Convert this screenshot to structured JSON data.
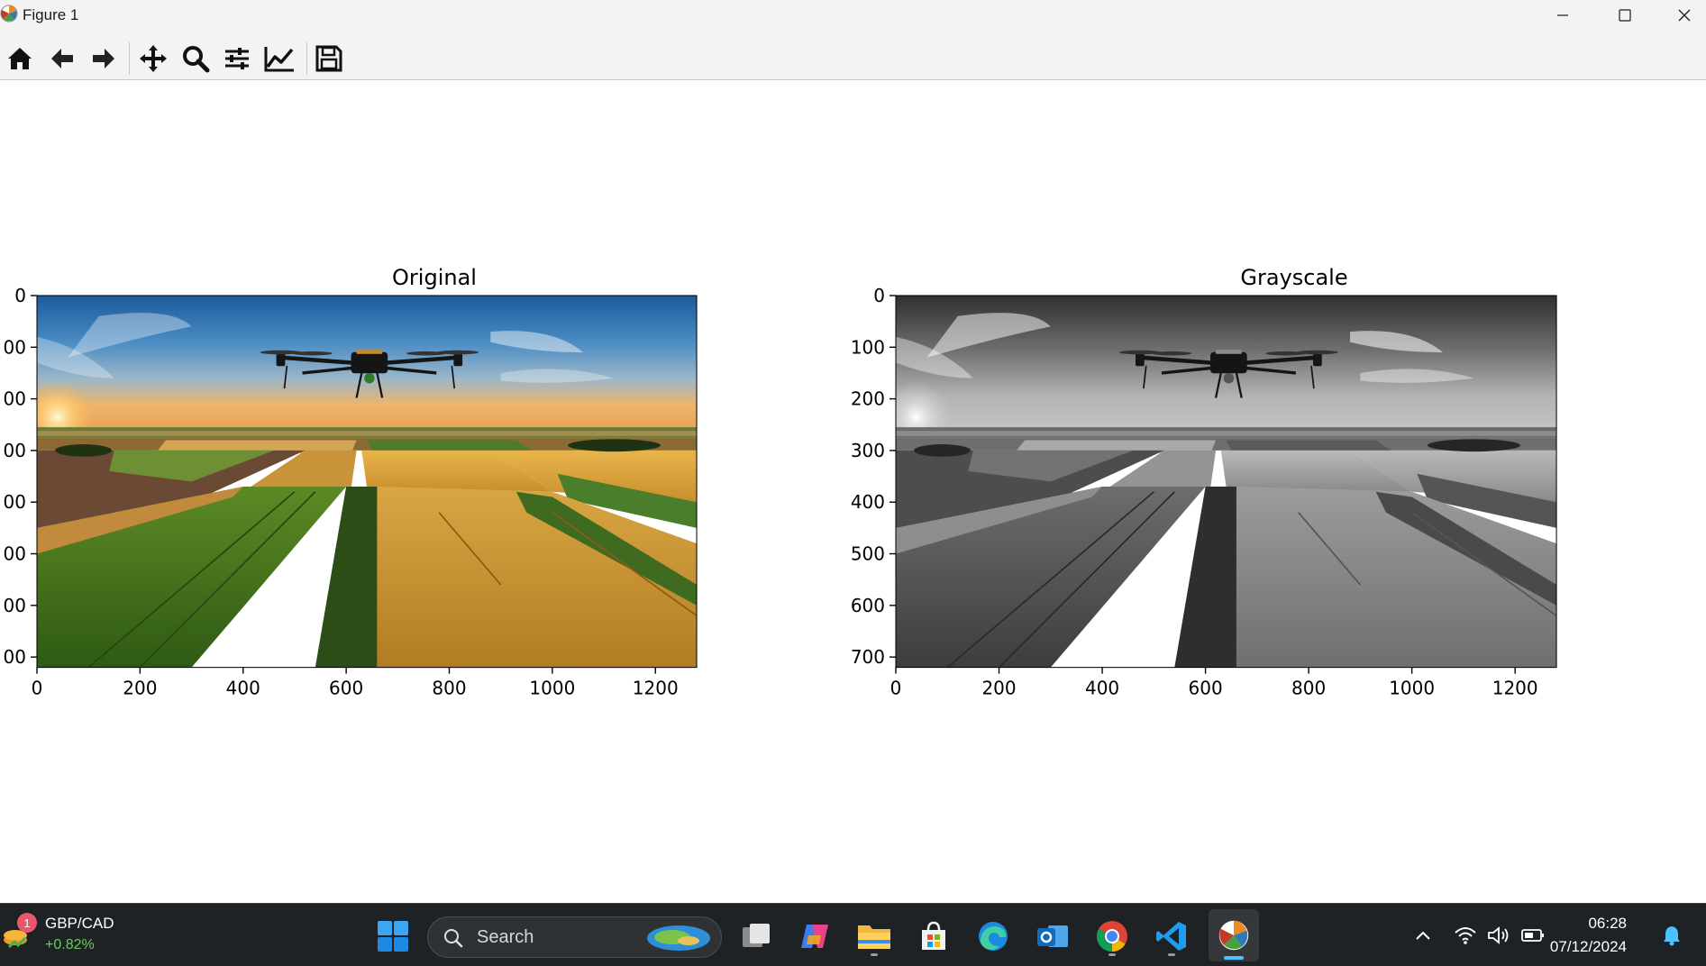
{
  "window": {
    "title": "Figure 1"
  },
  "toolbar": {
    "buttons": [
      {
        "name": "home-icon",
        "tooltip": "Reset original view"
      },
      {
        "name": "back-arrow-icon",
        "tooltip": "Back to previous view"
      },
      {
        "name": "forward-arrow-icon",
        "tooltip": "Forward to next view"
      },
      {
        "name": "pan-icon",
        "tooltip": "Pan"
      },
      {
        "name": "zoom-icon",
        "tooltip": "Zoom to rectangle"
      },
      {
        "name": "subplots-icon",
        "tooltip": "Configure subplots"
      },
      {
        "name": "axes-icon",
        "tooltip": "Edit axis"
      },
      {
        "name": "save-icon",
        "tooltip": "Save the figure"
      }
    ]
  },
  "chart_data": [
    {
      "type": "image",
      "title": "Original",
      "xlim": [
        0,
        1280
      ],
      "ylim": [
        720,
        0
      ],
      "xticks": [
        0,
        200,
        400,
        600,
        800,
        1000,
        1200
      ],
      "yticks": [
        0,
        100,
        200,
        300,
        400,
        500,
        600,
        700
      ],
      "xtick_labels": [
        "0",
        "200",
        "400",
        "600",
        "800",
        "1000",
        "1200"
      ],
      "ytick_labels": [
        "0",
        "00",
        "00",
        "00",
        "00",
        "00",
        "00",
        "00"
      ],
      "colormap": "rgb"
    },
    {
      "type": "image",
      "title": "Grayscale",
      "xlim": [
        0,
        1280
      ],
      "ylim": [
        720,
        0
      ],
      "xticks": [
        0,
        200,
        400,
        600,
        800,
        1000,
        1200
      ],
      "yticks": [
        0,
        100,
        200,
        300,
        400,
        500,
        600,
        700
      ],
      "xtick_labels": [
        "0",
        "200",
        "400",
        "600",
        "800",
        "1000",
        "1200"
      ],
      "ytick_labels": [
        "0",
        "100",
        "200",
        "300",
        "400",
        "500",
        "600",
        "700"
      ],
      "colormap": "gray"
    }
  ],
  "taskbar": {
    "ticker": {
      "name": "GBP/CAD",
      "change": "+0.82%",
      "badge": "1"
    },
    "search": {
      "placeholder": "Search"
    },
    "clock": {
      "time": "06:28",
      "date": "07/12/2024"
    },
    "colors": {
      "accent": "#4cc2ff",
      "positive": "#6ccb5f",
      "badge": "#e8576e"
    }
  }
}
